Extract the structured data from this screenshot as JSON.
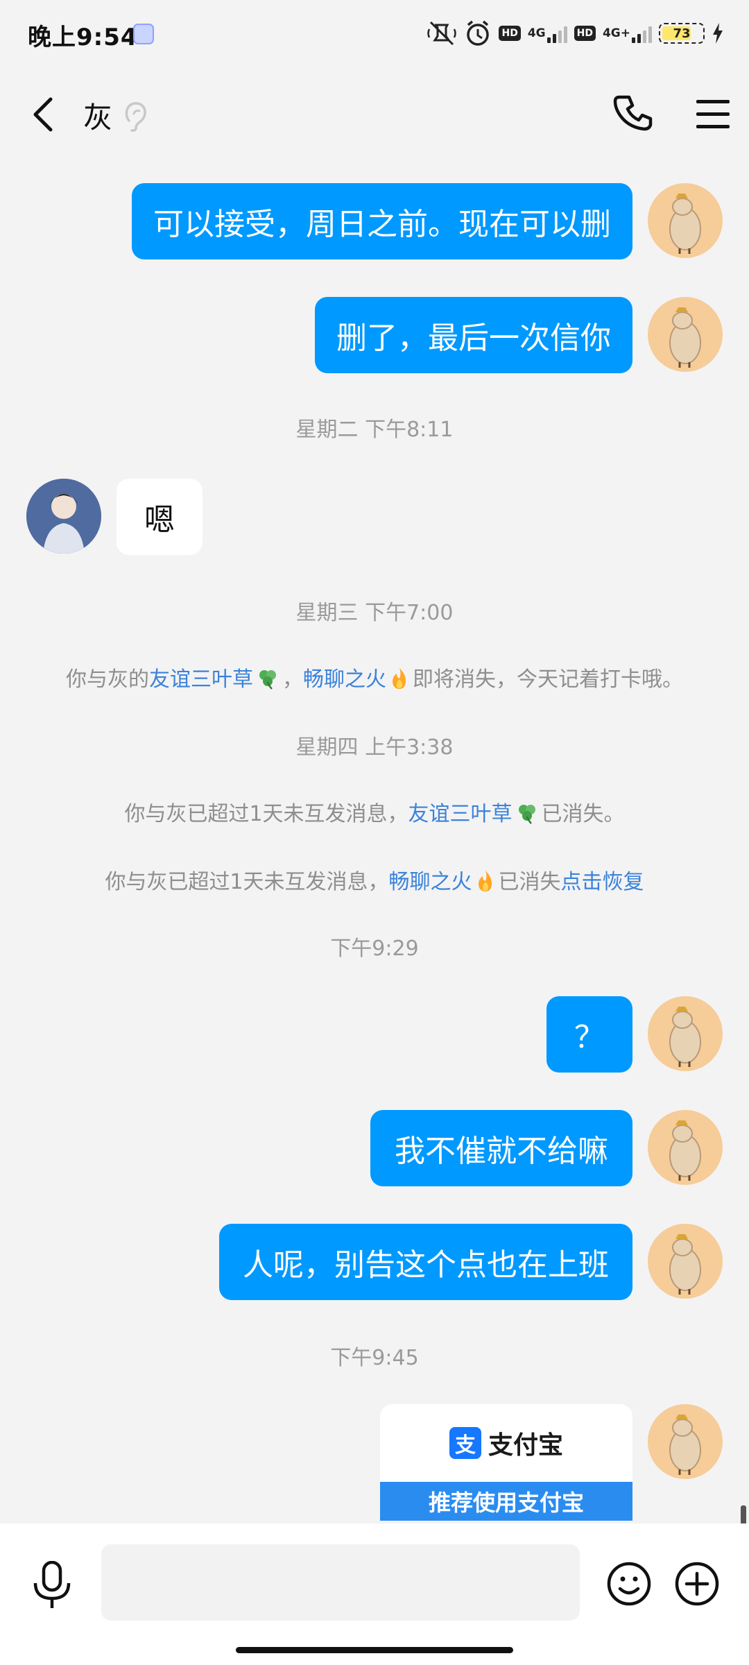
{
  "status_bar": {
    "time": "晚上9:54",
    "network_1": "4G",
    "network_2": "4G+",
    "hd_1": "HD",
    "hd_2": "HD",
    "battery": "73",
    "battery_level": 0.73
  },
  "header": {
    "title": "灰"
  },
  "messages": {
    "m1": "可以接受，周日之前。现在可以删",
    "m2": "删了，最后一次信你",
    "t1": "星期二 下午8:11",
    "m3": "嗯",
    "t2": "星期三 下午7:00",
    "sys1": {
      "prefix": "你与灰的",
      "link1": "友谊三叶草",
      "sep": "，",
      "link2": "畅聊之火",
      "suffix": "即将消失，今天记着打卡哦。"
    },
    "t3": "星期四 上午3:38",
    "sys2": {
      "prefix": "你与灰已超过1天未互发消息，",
      "link": "友谊三叶草",
      "suffix": "已消失。"
    },
    "sys3": {
      "prefix": "你与灰已超过1天未互发消息，",
      "link": "畅聊之火",
      "middle": "已消失",
      "action": "点击恢复"
    },
    "t4": "下午9:29",
    "m4": "？",
    "m5": "我不催就不给嘛",
    "m6": "人呢，别告这个点也在上班",
    "t5": "下午9:45",
    "card": {
      "logo": "支",
      "brand": "支付宝",
      "cta": "推荐使用支付宝"
    }
  },
  "input": {
    "value": "",
    "placeholder": ""
  },
  "colors": {
    "bubble_mine": "#0099ff",
    "bubble_theirs": "#ffffff",
    "link": "#3b82d9",
    "background": "#f3f3f4"
  }
}
